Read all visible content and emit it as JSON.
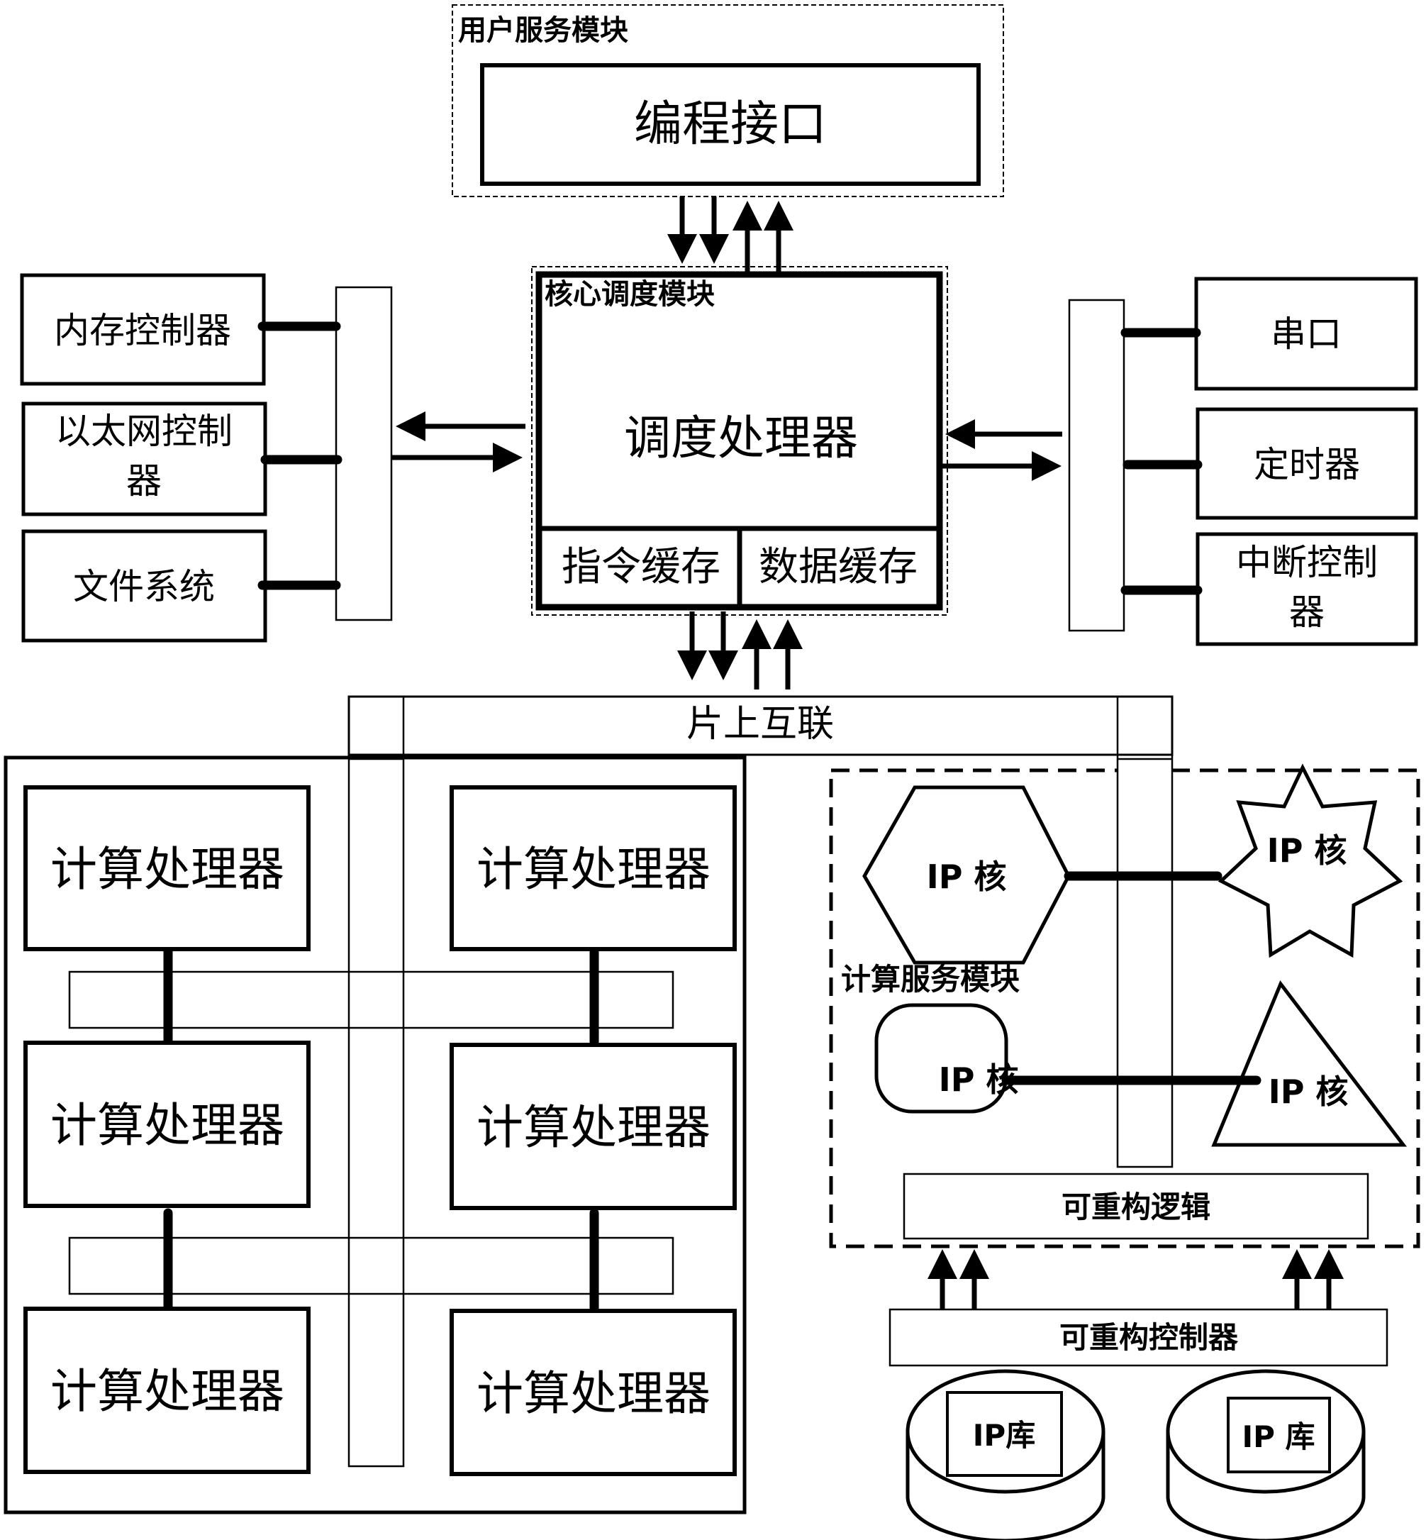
{
  "user_service_module": {
    "title": "用户服务模块",
    "programming_interface": "编程接口"
  },
  "core_scheduling_module": {
    "title": "核心调度模块",
    "scheduler": "调度处理器",
    "instruction_cache": "指令缓存",
    "data_cache": "数据缓存"
  },
  "left_peripherals": [
    {
      "label": "内存控制器"
    },
    {
      "label_line1": "以太网控制",
      "label_line2": "器"
    },
    {
      "label": "文件系统"
    }
  ],
  "right_peripherals": [
    {
      "label": "串口"
    },
    {
      "label": "定时器"
    },
    {
      "label_line1": "中断控制",
      "label_line2": "器"
    }
  ],
  "on_chip_interconnect": "片上互联",
  "compute_processors": [
    "计算处理器",
    "计算处理器",
    "计算处理器",
    "计算处理器",
    "计算处理器",
    "计算处理器"
  ],
  "compute_service_module": {
    "title": "计算服务模块",
    "ip_cores": [
      "IP 核",
      "IP 核",
      "IP 核",
      "IP 核"
    ],
    "reconfigurable_logic": "可重构逻辑"
  },
  "reconfigurable_controller": "可重构控制器",
  "ip_libraries": [
    "IP库",
    "IP 库"
  ]
}
